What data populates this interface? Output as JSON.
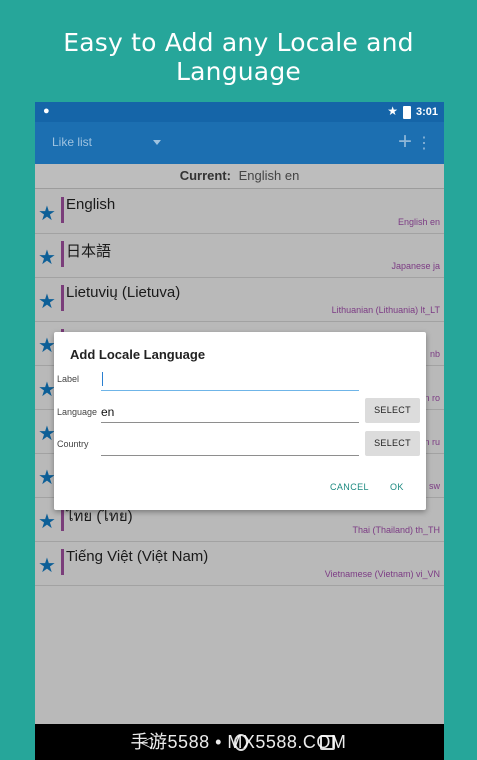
{
  "headline": "Easy to Add any Locale and Language",
  "status_bar": {
    "time": "3:01"
  },
  "action_bar": {
    "spinner_label": "Like list"
  },
  "current": {
    "label": "Current:",
    "value": "English en"
  },
  "list_rows": [
    {
      "name": "English",
      "code": "English en"
    },
    {
      "name": "日本語",
      "code": "Japanese ja"
    },
    {
      "name": "Lietuvių (Lietuva)",
      "code": "Lithuanian (Lithuania) lt_LT"
    },
    {
      "name": "",
      "code": "nb"
    },
    {
      "name": "",
      "code": "n ro"
    },
    {
      "name": "",
      "code": "n ru"
    },
    {
      "name": "",
      "code": "sw"
    },
    {
      "name": "ไทย (ไทย)",
      "code": "Thai (Thailand) th_TH"
    },
    {
      "name": "Tiếng Việt (Việt Nam)",
      "code": "Vietnamese (Vietnam) vi_VN"
    }
  ],
  "dialog": {
    "title": "Add Locale Language",
    "label_field": {
      "label": "Label",
      "value": ""
    },
    "language_field": {
      "label": "Language",
      "value": "en",
      "button": "SELECT"
    },
    "country_field": {
      "label": "Country",
      "value": "",
      "button": "SELECT"
    },
    "cancel": "CANCEL",
    "ok": "OK"
  },
  "watermark": "手游5588 • MX5588.COM",
  "icons": [
    "android-icon",
    "star-icon",
    "battery-icon",
    "dropdown-caret-icon",
    "add-icon",
    "overflow-menu-icon",
    "back-icon",
    "home-icon",
    "recent-apps-icon"
  ],
  "colors": {
    "background": "#26a69a",
    "appbar": "#1c6fb1",
    "accent": "#1c8a80",
    "star": "#0d5f97"
  }
}
